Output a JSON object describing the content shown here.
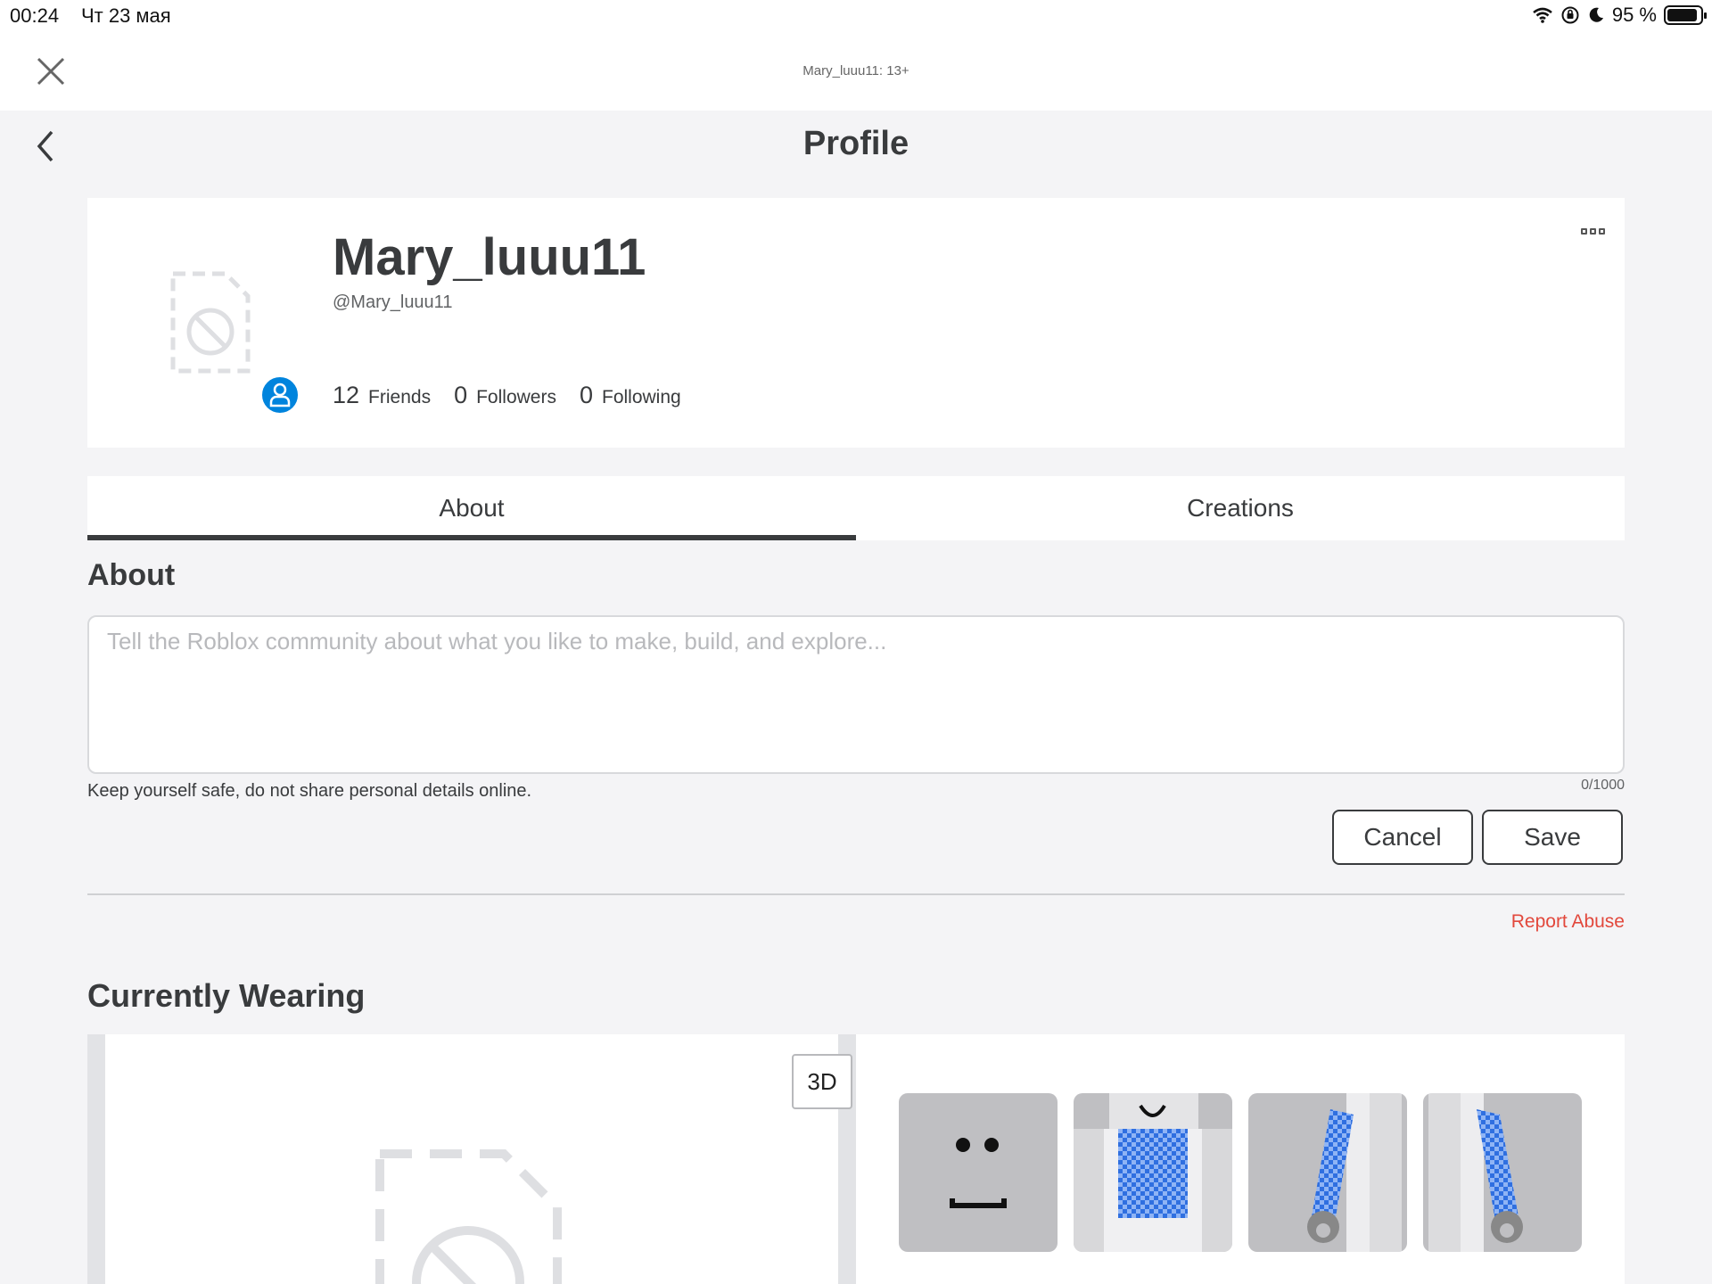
{
  "status_bar": {
    "time": "00:24",
    "date": "Чт 23 мая",
    "battery": "95 %"
  },
  "topbar": {
    "site_title": "Mary_luuu11: 13+"
  },
  "header": {
    "title": "Profile"
  },
  "profile": {
    "display_name": "Mary_luuu11",
    "handle": "@Mary_luuu11",
    "stats": [
      {
        "count": "12",
        "label": "Friends"
      },
      {
        "count": "0",
        "label": "Followers"
      },
      {
        "count": "0",
        "label": "Following"
      }
    ]
  },
  "tabs": [
    {
      "label": "About",
      "active": true
    },
    {
      "label": "Creations",
      "active": false
    }
  ],
  "about": {
    "heading": "About",
    "placeholder": "Tell the Roblox community about what you like to make, build, and explore...",
    "char_count": "0/1000",
    "safety_note": "Keep yourself safe, do not share personal details online.",
    "cancel_label": "Cancel",
    "save_label": "Save",
    "report_label": "Report Abuse"
  },
  "wearing": {
    "heading": "Currently Wearing",
    "button_3d": "3D",
    "items": [
      "face-item",
      "shirt-item",
      "left-arm-item",
      "right-arm-item"
    ]
  },
  "colors": {
    "accent": "#0084dd",
    "report": "#e2483c",
    "text": "#393b3d"
  }
}
